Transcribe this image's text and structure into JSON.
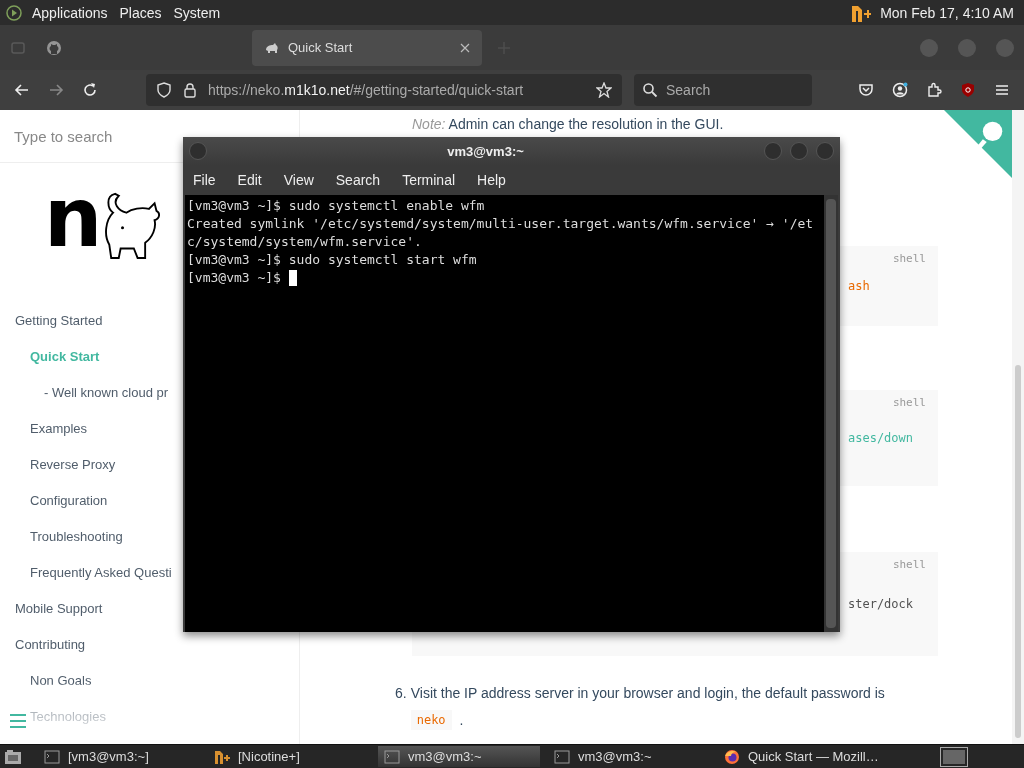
{
  "top_panel": {
    "menus": [
      "Applications",
      "Places",
      "System"
    ],
    "clock": "Mon Feb 17, 4:10 AM"
  },
  "browser": {
    "tabs": [
      {
        "kind": "github",
        "selected": false
      },
      {
        "kind": "neko",
        "label": "Quick Start",
        "selected": true
      }
    ],
    "address": "https://neko.**m1k1o.net**/#/getting-started/quick-start",
    "search": {
      "placeholder": "Search"
    }
  },
  "sidebar": {
    "search": {
      "placeholder": "Type to search"
    },
    "logo": "n",
    "nav": [
      {
        "label": "Getting Started",
        "selected": false,
        "children": [
          {
            "label": "Quick Start",
            "selected": true,
            "children": [
              {
                "label": "- Well known cloud pr",
                "selected": false
              }
            ]
          },
          {
            "label": "Examples",
            "selected": false
          },
          {
            "label": "Reverse Proxy",
            "selected": false
          },
          {
            "label": "Configuration",
            "selected": false
          },
          {
            "label": "Troubleshooting",
            "selected": false
          },
          {
            "label": "Frequently Asked Questi",
            "selected": false
          }
        ]
      },
      {
        "label": "Mobile Support",
        "selected": false
      },
      {
        "label": "Contributing",
        "selected": false,
        "children": [
          {
            "label": "Non Goals",
            "selected": false
          },
          {
            "label": "Technologies",
            "selected": false
          }
        ]
      }
    ]
  },
  "content": {
    "note": "*Note:* Admin can change the resolution in the GUI.",
    "code_blocks": [
      {
        "label": "shell",
        "text": "ash",
        "kind": "string"
      },
      {
        "label": "shell",
        "text": "ases/down",
        "kind": "link"
      },
      {
        "label": "shell",
        "text": "ster/dock",
        "kind": "plain"
      }
    ],
    "step": {
      "number": "6.",
      "text": "Visit the IP address server in your browser and login, the default password is",
      "code": "neko",
      "tail": "."
    }
  },
  "terminal": {
    "title": "vm3@vm3:~",
    "menus": [
      "File",
      "Edit",
      "View",
      "Search",
      "Terminal",
      "Help"
    ],
    "lines": [
      "[vm3@vm3 ~]$ sudo systemctl enable wfm",
      "Created symlink '/etc/systemd/system/multi-user.target.wants/wfm.service' → '/et",
      "c/systemd/system/wfm.service'.",
      "[vm3@vm3 ~]$ sudo systemctl start wfm",
      "[vm3@vm3 ~]$ "
    ]
  },
  "taskbar": {
    "items": [
      {
        "kind": "terminal",
        "label": "[vm3@vm3:~]",
        "selected": false
      },
      {
        "kind": "nicotine",
        "label": "[Nicotine+]",
        "selected": false
      },
      {
        "kind": "terminal",
        "label": "vm3@vm3:~",
        "selected": true
      },
      {
        "kind": "terminal",
        "label": "vm3@vm3:~",
        "selected": false
      },
      {
        "kind": "firefox",
        "label": "Quick Start — Mozill…",
        "selected": false
      }
    ]
  }
}
